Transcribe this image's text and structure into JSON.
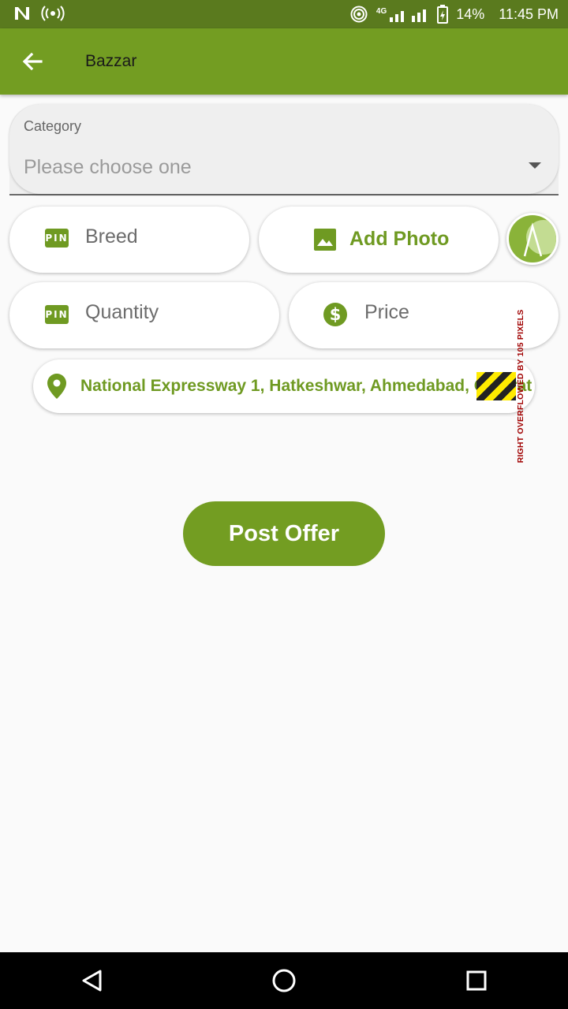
{
  "status_bar": {
    "battery": "14%",
    "time": "11:45 PM",
    "network": "4G"
  },
  "app_bar": {
    "title": "Bazzar"
  },
  "form": {
    "category_label": "Category",
    "category_placeholder": "Please choose one",
    "breed_label": "Breed",
    "add_photo_label": "Add Photo",
    "quantity_label": "Quantity",
    "price_label": "Price",
    "pin_icon_text": "PIN",
    "location_text": "National Expressway 1, Hatkeshwar, Ahmedabad, Gujarat",
    "overflow_warning": "RIGHT OVERFLOWED BY 105 PIXELS",
    "post_button": "Post Offer"
  },
  "colors": {
    "status_bar": "#5a7a1e",
    "primary": "#739d22",
    "accent_text": "#6f9a22",
    "background": "#fafafa"
  },
  "icons": [
    "arrow-back-icon",
    "pin-icon",
    "image-icon",
    "dollar-icon",
    "location-pin-icon",
    "avatar-logo-icon",
    "nav-back-icon",
    "nav-home-icon",
    "nav-recents-icon"
  ]
}
